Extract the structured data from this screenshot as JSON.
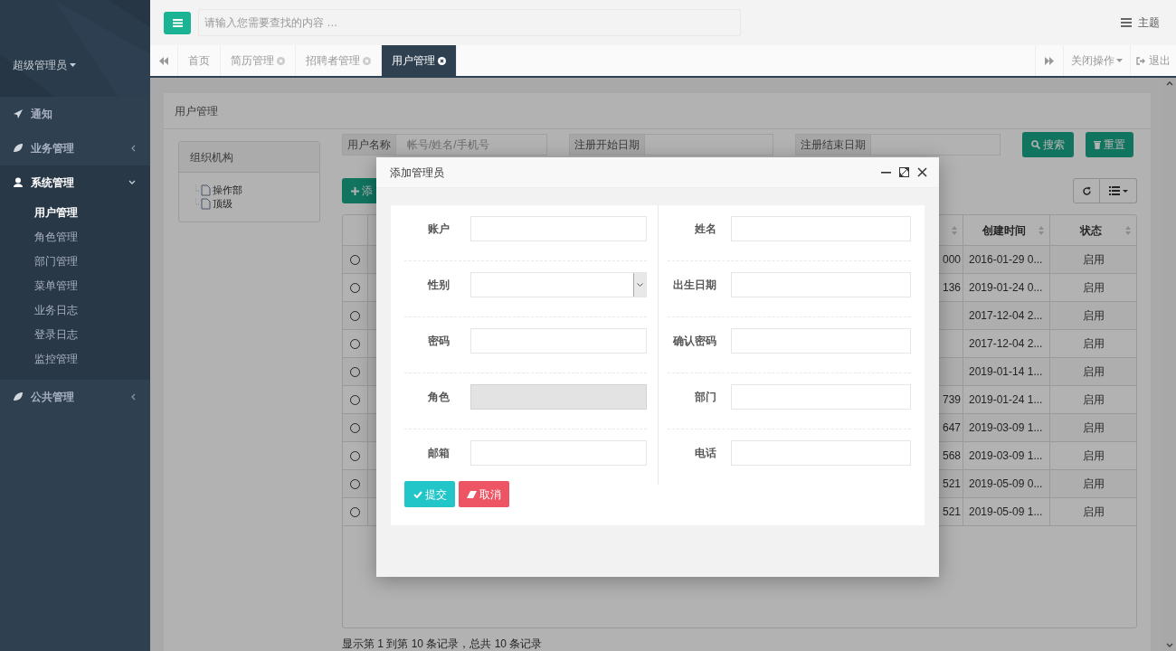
{
  "sidebar": {
    "profile": "超级管理员",
    "menu": [
      {
        "label": "通知"
      },
      {
        "label": "业务管理",
        "expanded": false
      },
      {
        "label": "系统管理",
        "expanded": true,
        "children": [
          {
            "label": "用户管理",
            "selected": true
          },
          {
            "label": "角色管理",
            "selected": false
          },
          {
            "label": "部门管理",
            "selected": false
          },
          {
            "label": "菜单管理",
            "selected": false
          },
          {
            "label": "业务日志",
            "selected": false
          },
          {
            "label": "登录日志",
            "selected": false
          },
          {
            "label": "监控管理",
            "selected": false
          }
        ]
      },
      {
        "label": "公共管理",
        "expanded": false
      }
    ]
  },
  "topbar": {
    "search_placeholder": "请输入您需要查找的内容 …",
    "theme": "主题"
  },
  "tabs": [
    {
      "label": "首页",
      "selected": false,
      "closable": false
    },
    {
      "label": "简历管理",
      "selected": false,
      "closable": true
    },
    {
      "label": "招聘者管理",
      "selected": false,
      "closable": true
    },
    {
      "label": "用户管理",
      "selected": true,
      "closable": true
    }
  ],
  "tab_actions": {
    "close_menu": "关闭操作",
    "logout": "退出"
  },
  "page": {
    "title": "用户管理",
    "tree": {
      "title": "组织机构",
      "items": [
        "操作部",
        "顶级"
      ]
    },
    "filters": [
      {
        "label": "用户名称",
        "placeholder": "帐号/姓名/手机号"
      },
      {
        "label": "注册开始日期"
      },
      {
        "label": "注册结束日期"
      }
    ],
    "buttons": {
      "search": "搜索",
      "reset": "重置",
      "add": "添"
    },
    "table": {
      "columns": [
        "创建时间",
        "状态"
      ],
      "rows": [
        {
          "selected": false,
          "column_2": "000",
          "created": "2016-01-29 0...",
          "status": "启用"
        },
        {
          "selected": false,
          "column_2": "136",
          "created": "2019-01-24 0...",
          "status": "启用"
        },
        {
          "selected": false,
          "created": "2017-12-04 2...",
          "status": "启用"
        },
        {
          "selected": false,
          "created": "2017-12-04 2...",
          "status": "启用"
        },
        {
          "selected": false,
          "created": "2019-01-14 1...",
          "status": "启用"
        },
        {
          "selected": false,
          "column_2": "739",
          "created": "2019-01-24 1...",
          "status": "启用"
        },
        {
          "selected": false,
          "column_2": "647",
          "created": "2019-03-09 1...",
          "status": "启用"
        },
        {
          "selected": false,
          "column_2": "568",
          "created": "2019-03-09 1...",
          "status": "启用"
        },
        {
          "selected": false,
          "column_2": "521",
          "created": "2019-05-09 0...",
          "status": "启用"
        },
        {
          "selected": false,
          "column_2": "521",
          "created": "2019-05-09 1...",
          "status": "启用"
        }
      ]
    },
    "footer": "显示第 1 到第 10 条记录，总共 10 条记录"
  },
  "modal": {
    "title": "添加管理员",
    "fields": [
      {
        "label": "账户",
        "kind": "text",
        "disabled": false
      },
      {
        "label": "姓名",
        "kind": "text",
        "disabled": false
      },
      {
        "label": "性别",
        "kind": "select",
        "disabled": false
      },
      {
        "label": "出生日期",
        "kind": "text",
        "disabled": false
      },
      {
        "label": "密码",
        "kind": "text",
        "disabled": false
      },
      {
        "label": "确认密码",
        "kind": "text",
        "disabled": false
      },
      {
        "label": "角色",
        "kind": "text",
        "disabled": true
      },
      {
        "label": "部门",
        "kind": "text",
        "disabled": false
      },
      {
        "label": "邮箱",
        "kind": "text",
        "disabled": false
      },
      {
        "label": "电话",
        "kind": "text",
        "disabled": false
      }
    ],
    "submit": "提交",
    "cancel": "取消"
  }
}
